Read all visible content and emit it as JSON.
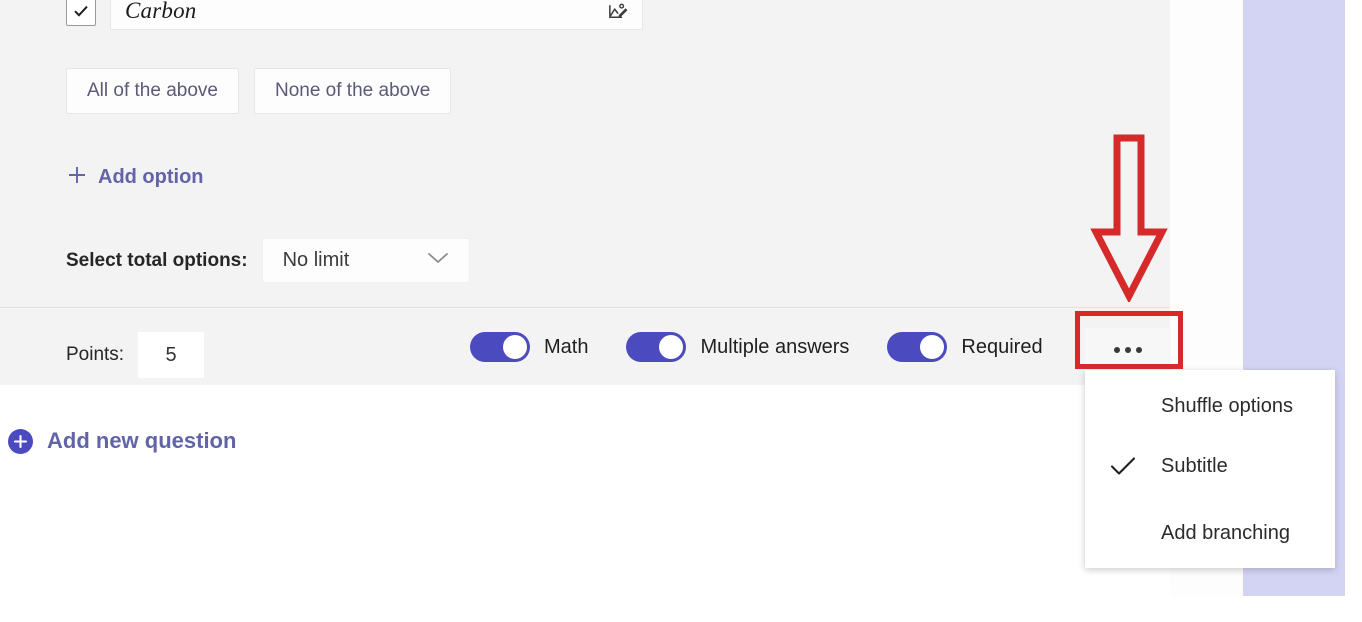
{
  "question_card": {
    "option": {
      "checkbox_checked": true,
      "text": "Carbon",
      "image_icon": "image-insert-icon"
    },
    "preset_options": [
      {
        "label": "All of the above"
      },
      {
        "label": "None of the above"
      }
    ],
    "add_option": {
      "icon": "plus-icon",
      "label": "Add option"
    },
    "select_total": {
      "label": "Select total options:",
      "value": "No limit",
      "chevron": "chevron-down-icon"
    },
    "footer": {
      "points_label": "Points:",
      "points_value": "5",
      "toggles": [
        {
          "label": "Math",
          "on": true
        },
        {
          "label": "Multiple answers",
          "on": true
        },
        {
          "label": "Required",
          "on": true
        }
      ],
      "more_button": {
        "icon": "ellipsis-icon",
        "dots": "•••"
      }
    }
  },
  "more_menu": {
    "items": [
      {
        "label": "Shuffle options",
        "checked": false
      },
      {
        "label": "Subtitle",
        "checked": true
      },
      {
        "label": "Add branching",
        "checked": false
      }
    ]
  },
  "add_new_question": {
    "icon": "plus-circle-icon",
    "label": "Add new question"
  },
  "annotations": {
    "arrow": {
      "name": "red-down-arrow",
      "color": "#d62929",
      "direction": "down"
    },
    "highlight_box": {
      "name": "red-highlight-box",
      "color": "#d62929",
      "target": "more-button"
    }
  },
  "colors": {
    "accent_purple": "#6264a7",
    "toggle_on": "#4b4bbf",
    "annotation_red": "#d62929",
    "card_bg": "#f3f3f3",
    "lavender_panel": "#d3d4f4"
  }
}
